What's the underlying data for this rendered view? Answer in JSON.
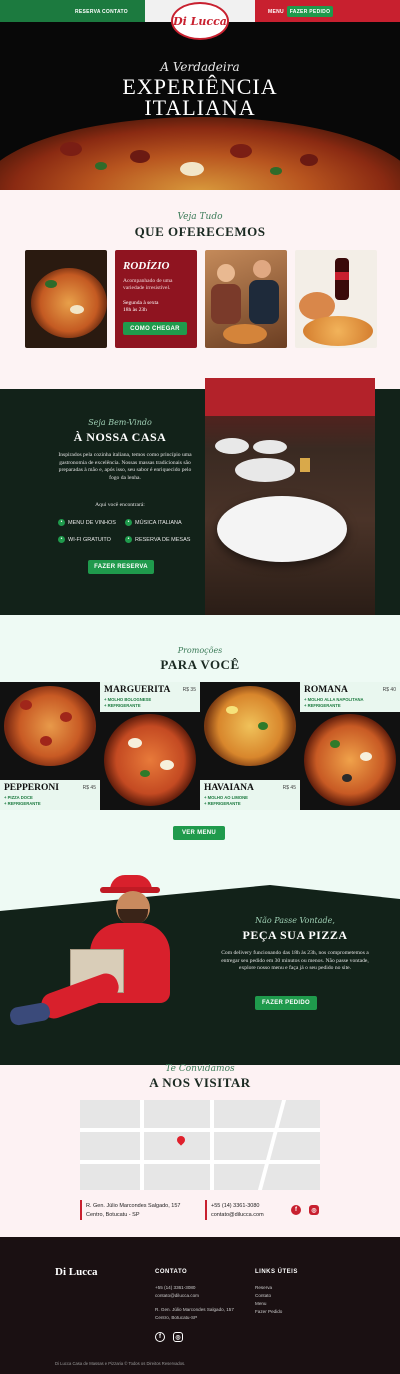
{
  "nav": {
    "reserva": "RESERVA",
    "contato": "CONTATO",
    "menu": "MENU",
    "pedido": "FAZER PEDIDO",
    "logo": "Di Lucca"
  },
  "hero": {
    "script": "A Verdadeira",
    "title1": "EXPERIÊNCIA",
    "title2": "ITALIANA"
  },
  "offer": {
    "script": "Veja Tudo",
    "title": "QUE OFERECEMOS",
    "card": {
      "title": "RODÍZIO",
      "desc": "Acompanhado de uma variedade irresistível.",
      "hours1": "Segunda à sexta",
      "hours2": "18h às 23h",
      "button": "COMO CHEGAR"
    }
  },
  "casa": {
    "script": "Seja Bem-Vindo",
    "title": "À NOSSA CASA",
    "text": "Inspirados pela cozinha italiana, temos como princípio uma gastronomia de excelência. Nossas massas tradicionais são preparadas à mão e, após isso, seu sabor é enriquecido pelo fogo da lenha.",
    "find": "Aqui você encontrará:",
    "features": [
      "MENU DE VINHOS",
      "MÚSICA ITALIANA",
      "WI-FI GRATUITO",
      "RESERVA DE MESAS"
    ],
    "button": "FAZER RESERVA"
  },
  "promo": {
    "script": "Promoções",
    "title": "PARA VOCÊ",
    "button": "VER MENU",
    "items": [
      {
        "name": "MARGUERITA",
        "price": "R$ 35",
        "extras": [
          "+ MOLHO BOLOGNESE",
          "+ REFRIGERANTE"
        ]
      },
      {
        "name": "ROMANA",
        "price": "R$ 40",
        "extras": [
          "+ MOLHO ALLA NAPOLITANA",
          "+ REFRIGERANTE"
        ]
      },
      {
        "name": "PEPPERONI",
        "price": "R$ 45",
        "extras": [
          "+ PIZZA DOCE",
          "+ REFRIGERANTE"
        ]
      },
      {
        "name": "HAVAIANA",
        "price": "R$ 45",
        "extras": [
          "+ MOLHO AO LIMONE",
          "+ REFRIGERANTE"
        ]
      }
    ]
  },
  "deliv": {
    "script": "Não Passe Vontade,",
    "title": "PEÇA SUA PIZZA",
    "text": "Com delivery funcionando das 18h às 23h, nos comprometemos a entregar seu pedido em 30 minutos ou menos. Não passe vontade, explore nosso menu e faça já o seu pedido no site.",
    "button": "FAZER PEDIDO"
  },
  "visit": {
    "script": "Te Convidamos",
    "title": "A NOS VISITAR",
    "addr1": "R. Gen. Júlio Marcondes Salgado, 157",
    "addr2": "Centro, Botucatu - SP",
    "phone": "+55 (14) 3361-3080",
    "email": "contato@dilucca.com"
  },
  "foot": {
    "brand": "Di Lucca",
    "contato_h": "CONTATO",
    "links_h": "LINKS ÚTEIS",
    "phone": "+55 (14) 3361-3080",
    "email": "contato@dilucca.com",
    "addr1": "R. Gen. Júlio Marcondes Salgado, 157",
    "addr2": "Centro, Botucatu-SP",
    "links": [
      "Reserva",
      "Contato",
      "Menu",
      "Fazer Pedido"
    ],
    "copy": "Di Lucca Casa de Massas e Pizzaria © Todos os Direitos Reservados."
  }
}
